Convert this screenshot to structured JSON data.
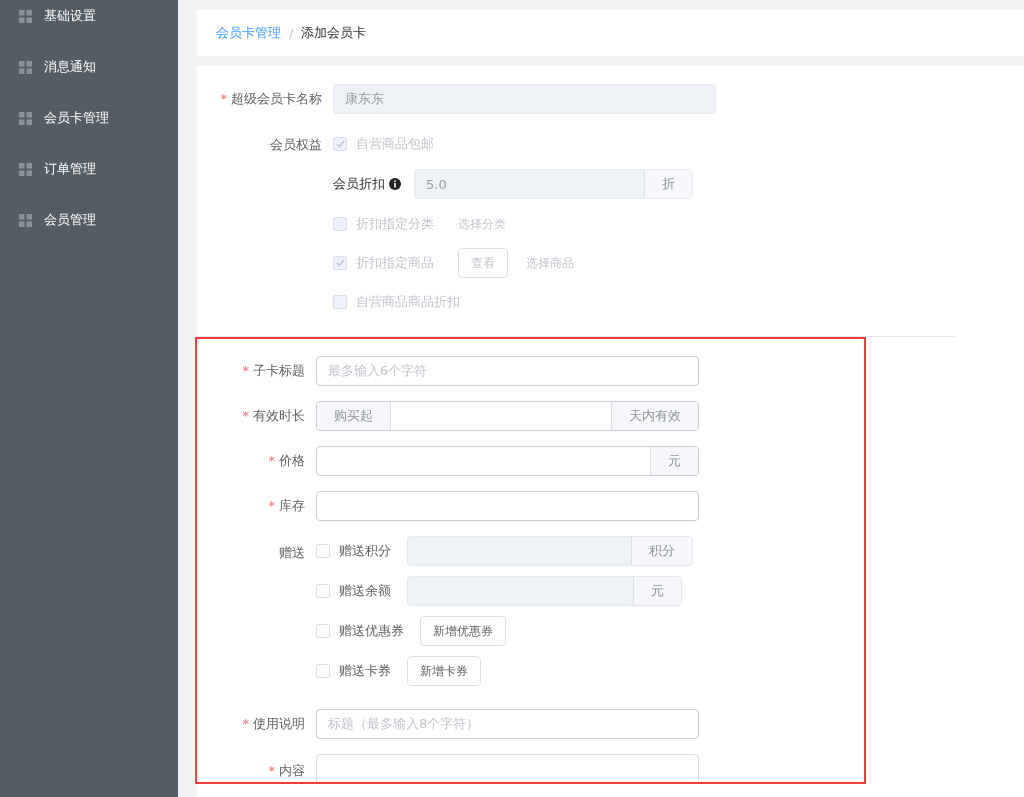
{
  "sidebar": {
    "items": [
      {
        "label": "基础设置"
      },
      {
        "label": "消息通知"
      },
      {
        "label": "会员卡管理"
      },
      {
        "label": "订单管理"
      },
      {
        "label": "会员管理"
      }
    ]
  },
  "breadcrumb": {
    "items": [
      {
        "label": "会员卡管理",
        "kind": "link"
      },
      {
        "label": "添加会员卡",
        "kind": "current"
      }
    ],
    "separator": "/"
  },
  "card_form": {
    "name_field": {
      "label": "超级会员卡名称",
      "required_mark": "*",
      "value": "康东东",
      "disabled": true
    },
    "benefits": {
      "label": "会员权益",
      "items": [
        {
          "kind": "checkbox",
          "label": "自营商品包邮",
          "checked": true,
          "disabled": true
        },
        {
          "kind": "discount",
          "label": "会员折扣",
          "value": "5.0",
          "suffix": "折",
          "disabled": true
        },
        {
          "kind": "checkbox",
          "label": "折扣指定分类",
          "checked": false,
          "disabled": true,
          "link": "选择分类"
        },
        {
          "kind": "checkbox",
          "label": "折扣指定商品",
          "checked": true,
          "disabled": true,
          "button": "查看",
          "link": "选择商品"
        },
        {
          "kind": "checkbox",
          "label": "自营商品商品折扣",
          "checked": false,
          "disabled": true
        }
      ]
    }
  },
  "sub_card_form": {
    "fields": [
      {
        "kind": "text",
        "label": "子卡标题",
        "required_mark": "*",
        "placeholder": "最多输入6个字符"
      },
      {
        "kind": "text",
        "label": "有效时长",
        "required_mark": "*",
        "prefix": "购买起",
        "suffix": "天内有效"
      },
      {
        "kind": "text",
        "label": "价格",
        "required_mark": "*",
        "suffix": "元"
      },
      {
        "kind": "text",
        "label": "库存",
        "required_mark": "*"
      },
      {
        "kind": "gifts",
        "label": "赠送",
        "items": [
          {
            "label": "赠送积分",
            "checked": false,
            "suffix": "积分",
            "disabled": true
          },
          {
            "label": "赠送余额",
            "checked": false,
            "suffix": "元",
            "disabled": true
          },
          {
            "label": "赠送优惠券",
            "checked": false,
            "button": "新增优惠券"
          },
          {
            "label": "赠送卡券",
            "checked": false,
            "button": "新增卡券"
          }
        ]
      },
      {
        "kind": "text",
        "label": "使用说明",
        "required_mark": "*",
        "placeholder": "标题（最多输入8个字符）"
      },
      {
        "kind": "textarea",
        "label": "内容",
        "required_mark": "*"
      }
    ]
  }
}
